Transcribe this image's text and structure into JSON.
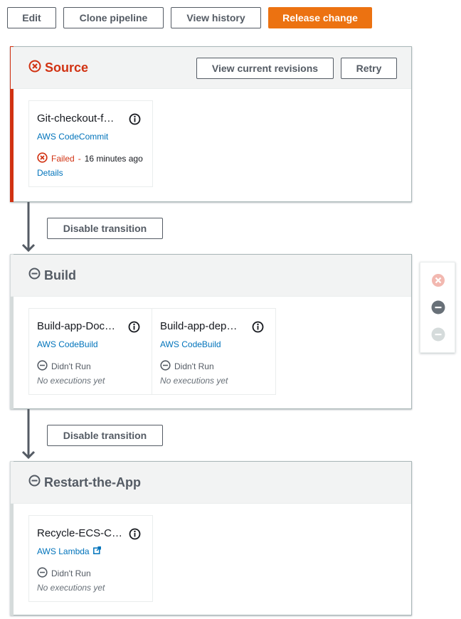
{
  "toolbar": {
    "edit": "Edit",
    "clone": "Clone pipeline",
    "history": "View history",
    "release": "Release change"
  },
  "stages": {
    "source": {
      "title": "Source",
      "view_revisions": "View current revisions",
      "retry": "Retry",
      "action": {
        "name": "Git-checkout-f…",
        "provider": "AWS CodeCommit",
        "status": "Failed",
        "separator": "-",
        "time": "16 minutes ago",
        "details": "Details"
      }
    },
    "build": {
      "title": "Build",
      "actions": [
        {
          "name": "Build-app-Doc…",
          "provider": "AWS CodeBuild",
          "status": "Didn't Run",
          "sub": "No executions yet"
        },
        {
          "name": "Build-app-dep…",
          "provider": "AWS CodeBuild",
          "status": "Didn't Run",
          "sub": "No executions yet"
        }
      ]
    },
    "restart": {
      "title": "Restart-the-App",
      "action": {
        "name": "Recycle-ECS-C…",
        "provider": "AWS Lambda",
        "status": "Didn't Run",
        "sub": "No executions yet"
      }
    }
  },
  "transitions": {
    "t1": "Disable transition",
    "t2": "Disable transition"
  },
  "colors": {
    "accent_orange": "#ec7211",
    "failed_red": "#d13212",
    "link_blue": "#0073bb",
    "neutral_grey": "#545b64"
  }
}
